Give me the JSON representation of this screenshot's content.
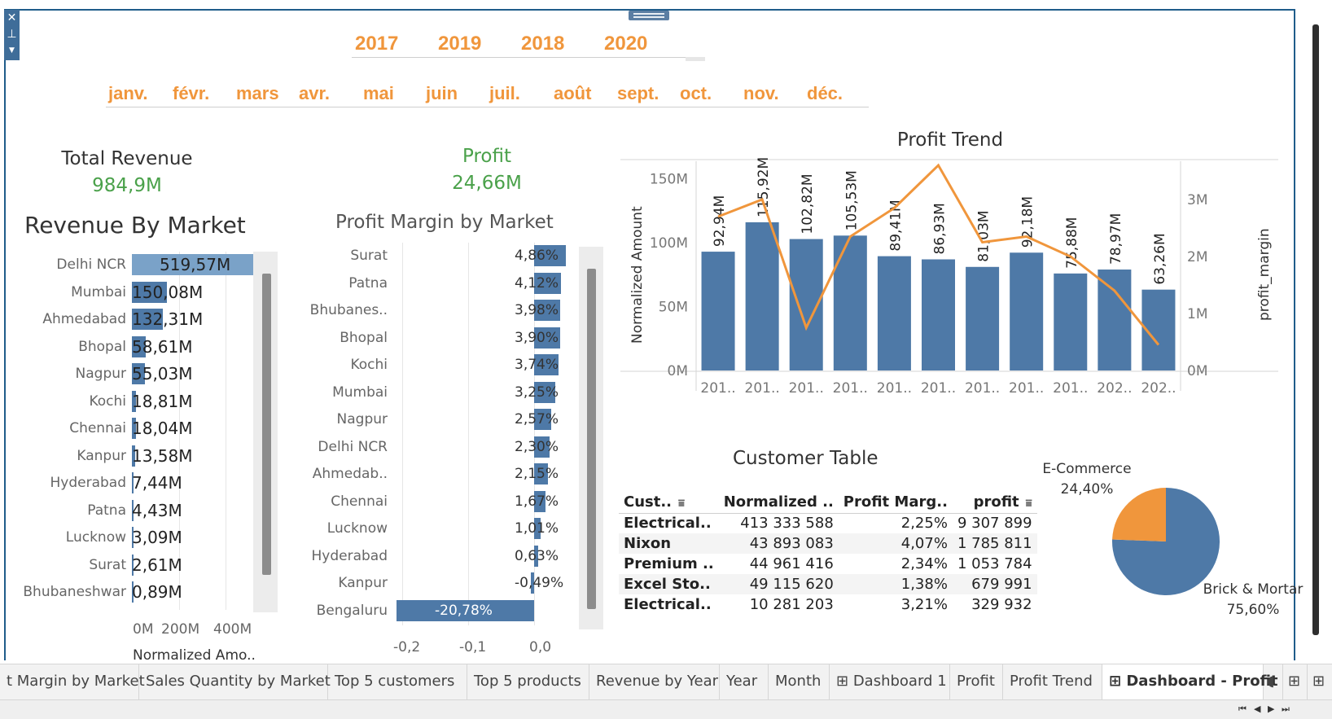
{
  "filters": {
    "years": [
      "2017",
      "2019",
      "2018",
      "2020"
    ],
    "months": [
      "janv.",
      "févr.",
      "mars",
      "avr.",
      "mai",
      "juin",
      "juil.",
      "août",
      "sept.",
      "oct.",
      "nov.",
      "déc."
    ]
  },
  "kpi": {
    "revenue_title": "Total Revenue",
    "revenue_value": "984,9M",
    "profit_title": "Profit",
    "profit_value": "24,66M"
  },
  "revenue_by_market": {
    "title": "Revenue By Market",
    "axis_label": "Normalized Amo..",
    "ticks": [
      "0M",
      "200M",
      "400M"
    ],
    "rows": [
      {
        "market": "Delhi NCR",
        "value": 519.57,
        "label": "519,57M"
      },
      {
        "market": "Mumbai",
        "value": 150.08,
        "label": "150,08M"
      },
      {
        "market": "Ahmedabad",
        "value": 132.31,
        "label": "132,31M"
      },
      {
        "market": "Bhopal",
        "value": 58.61,
        "label": "58,61M"
      },
      {
        "market": "Nagpur",
        "value": 55.03,
        "label": "55,03M"
      },
      {
        "market": "Kochi",
        "value": 18.81,
        "label": "18,81M"
      },
      {
        "market": "Chennai",
        "value": 18.04,
        "label": "18,04M"
      },
      {
        "market": "Kanpur",
        "value": 13.58,
        "label": "13,58M"
      },
      {
        "market": "Hyderabad",
        "value": 7.44,
        "label": "7,44M"
      },
      {
        "market": "Patna",
        "value": 4.43,
        "label": "4,43M"
      },
      {
        "market": "Lucknow",
        "value": 3.09,
        "label": "3,09M"
      },
      {
        "market": "Surat",
        "value": 2.61,
        "label": "2,61M"
      },
      {
        "market": "Bhubaneshwar",
        "value": 0.89,
        "label": "0,89M"
      }
    ]
  },
  "profit_margin_by_market": {
    "title": "Profit Margin by Market",
    "ticks": [
      "-0,2",
      "-0,1",
      "0,0"
    ],
    "rows": [
      {
        "market": "Surat",
        "value": 4.86,
        "label": "4,86%"
      },
      {
        "market": "Patna",
        "value": 4.12,
        "label": "4,12%"
      },
      {
        "market": "Bhubanes..",
        "value": 3.98,
        "label": "3,98%"
      },
      {
        "market": "Bhopal",
        "value": 3.9,
        "label": "3,90%"
      },
      {
        "market": "Kochi",
        "value": 3.74,
        "label": "3,74%"
      },
      {
        "market": "Mumbai",
        "value": 3.25,
        "label": "3,25%"
      },
      {
        "market": "Nagpur",
        "value": 2.57,
        "label": "2,57%"
      },
      {
        "market": "Delhi NCR",
        "value": 2.3,
        "label": "2,30%"
      },
      {
        "market": "Ahmedab..",
        "value": 2.15,
        "label": "2,15%"
      },
      {
        "market": "Chennai",
        "value": 1.67,
        "label": "1,67%"
      },
      {
        "market": "Lucknow",
        "value": 1.01,
        "label": "1,01%"
      },
      {
        "market": "Hyderabad",
        "value": 0.63,
        "label": "0,63%"
      },
      {
        "market": "Kanpur",
        "value": -0.49,
        "label": "-0,49%"
      },
      {
        "market": "Bengaluru",
        "value": -20.78,
        "label": "-20,78%"
      }
    ]
  },
  "chart_data": {
    "type": "bar",
    "title": "Profit Trend",
    "ylabel": "Normalized Amount",
    "y2label": "profit_margin",
    "y_ticks": [
      "0M",
      "50M",
      "100M",
      "150M"
    ],
    "y2_ticks": [
      "0M",
      "1M",
      "2M",
      "3M"
    ],
    "ylim": [
      0,
      165
    ],
    "y2lim": [
      0,
      3.6
    ],
    "categories": [
      "201..",
      "201..",
      "201..",
      "201..",
      "201..",
      "201..",
      "201..",
      "201..",
      "201..",
      "202..",
      "202.."
    ],
    "series": [
      {
        "values": [
          92.94,
          115.92,
          102.82,
          105.53,
          89.41,
          86.93,
          81.03,
          92.18,
          75.88,
          78.97,
          63.26
        ],
        "labels": [
          "92,94M",
          "115,92M",
          "102,82M",
          "105,53M",
          "89,41M",
          "86,93M",
          "81,03M",
          "92,18M",
          "75,88M",
          "78,97M",
          "63,26M"
        ]
      },
      {
        "type": "line",
        "axis": "y2",
        "values": [
          2.7,
          3.0,
          0.75,
          2.35,
          2.85,
          3.6,
          2.25,
          2.35,
          2.0,
          1.4,
          0.45
        ]
      }
    ]
  },
  "customer_table": {
    "title": "Customer Table",
    "headers": [
      "Cust..",
      "Normalized ..",
      "Profit Marg..",
      "profit"
    ],
    "rows": [
      [
        "Electrical..",
        "413 333 588",
        "2,25%",
        "9 307 899"
      ],
      [
        "Nixon",
        "43 893 083",
        "4,07%",
        "1 785 811"
      ],
      [
        "Premium ..",
        "44 961 416",
        "2,34%",
        "1 053 784"
      ],
      [
        "Excel Sto..",
        "49 115 620",
        "1,38%",
        "679 991"
      ],
      [
        "Electrical..",
        "10 281 203",
        "3,21%",
        "329 932"
      ]
    ]
  },
  "pie": {
    "slices": [
      {
        "name": "E-Commerce",
        "value": 24.4,
        "label": "24,40%"
      },
      {
        "name": "Brick & Mortar",
        "value": 75.6,
        "label": "75,60%"
      }
    ]
  },
  "tabs": [
    "t Margin by Market",
    "Sales Quantity by Market",
    "Top 5 customers",
    "Top 5 products",
    "Revenue by Year",
    "Year",
    "Month",
    "Dashboard 1",
    "Profit",
    "Profit Trend",
    "Dashboard - Profit"
  ],
  "colors": {
    "bar": "#4e79a7",
    "orange": "#f0963c",
    "green": "#4aa14a"
  }
}
